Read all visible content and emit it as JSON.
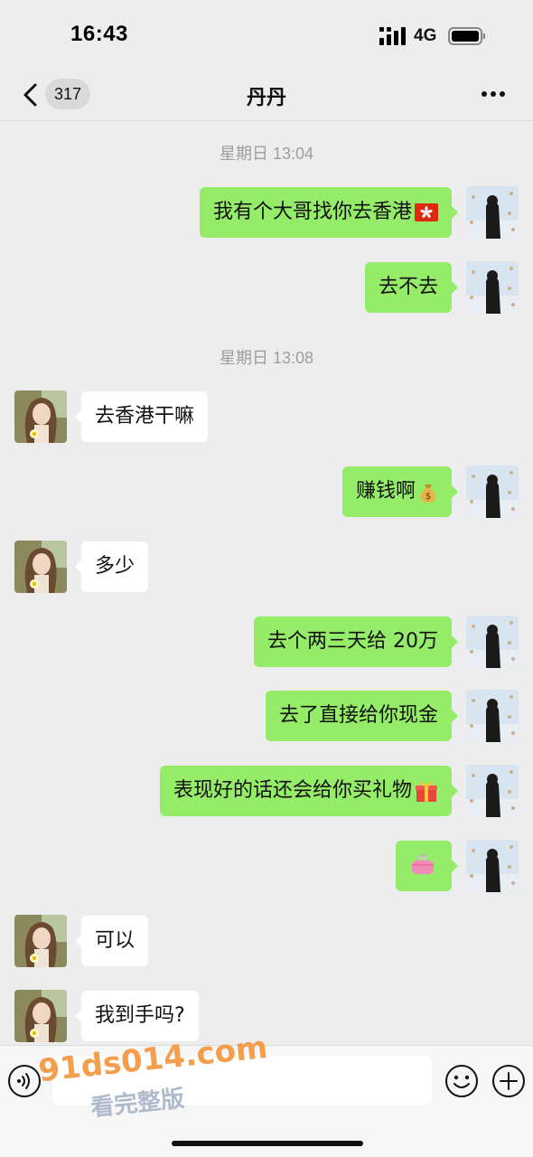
{
  "status_bar": {
    "time": "16:43",
    "network": "4G"
  },
  "nav": {
    "unread_count": "317",
    "title": "丹丹"
  },
  "messages": [
    {
      "type": "timestamp",
      "text": "星期日 13:04"
    },
    {
      "type": "out",
      "text": "我有个大哥找你去香港",
      "emoji": "hong-kong-flag-icon"
    },
    {
      "type": "out",
      "text": "去不去"
    },
    {
      "type": "timestamp",
      "text": "星期日 13:08"
    },
    {
      "type": "in",
      "text": "去香港干嘛"
    },
    {
      "type": "out",
      "text": "赚钱啊",
      "emoji": "money-bag-icon"
    },
    {
      "type": "in",
      "text": "多少"
    },
    {
      "type": "out",
      "text": "去个两三天给 20万"
    },
    {
      "type": "out",
      "text": "去了直接给你现金"
    },
    {
      "type": "out",
      "text": "表现好的话还会给你买礼物",
      "emoji": "gift-icon"
    },
    {
      "type": "out",
      "text": "",
      "emoji": "purse-icon"
    },
    {
      "type": "in",
      "text": "可以"
    },
    {
      "type": "in",
      "text": "我到手吗?"
    }
  ],
  "input": {
    "placeholder": ""
  },
  "watermark": {
    "url": "91ds014.com",
    "caption": "看完整版"
  },
  "colors": {
    "background": "#ededed",
    "outgoing_bubble": "#95ec69",
    "incoming_bubble": "#ffffff",
    "timestamp": "#9e9e9e"
  }
}
